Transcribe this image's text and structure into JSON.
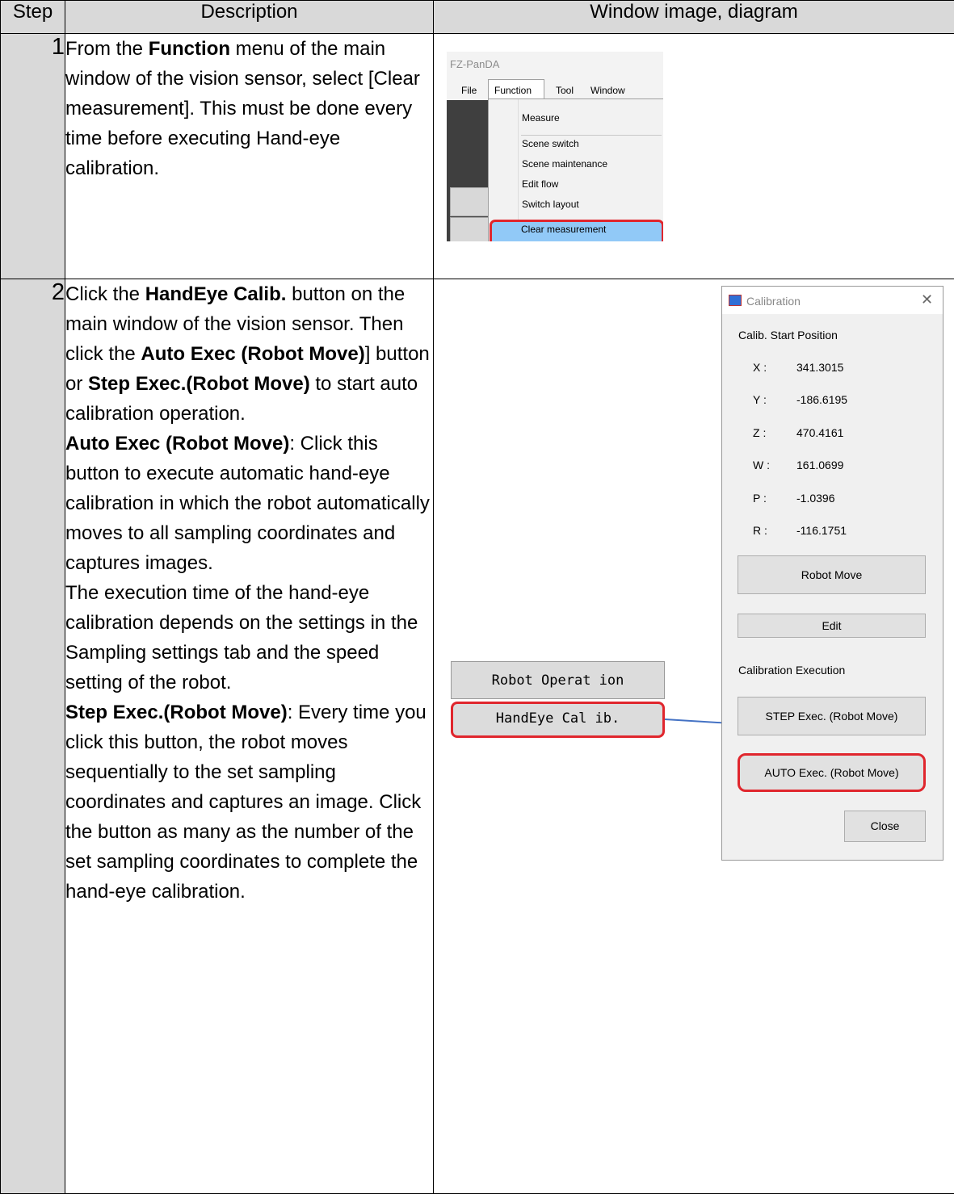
{
  "table": {
    "headers": [
      "Step",
      "Description",
      "Window image, diagram"
    ]
  },
  "step1": {
    "number": "1",
    "description_parts": [
      {
        "t": "From the ",
        "b": false
      },
      {
        "t": "Function",
        "b": true
      },
      {
        "t": " menu of the main window of the vision sensor, select [Clear measurement]. This must be done every time before executing Hand-eye calibration.",
        "b": false
      }
    ],
    "window": {
      "title": "FZ-PanDA",
      "menubar": [
        "File",
        "Function",
        "Tool",
        "Window"
      ],
      "menu_items": [
        "Measure",
        "Scene switch",
        "Scene maintenance",
        "Edit flow",
        "Switch layout",
        "Clear measurement"
      ],
      "highlighted_item": "Clear measurement"
    }
  },
  "step2": {
    "number": "2",
    "description_parts": [
      {
        "t": "Click the ",
        "b": false
      },
      {
        "t": "HandEye Calib.",
        "b": true
      },
      {
        "t": " button on the main window of the vision sensor. Then click the ",
        "b": false
      },
      {
        "t": "Auto Exec (Robot Move)",
        "b": true
      },
      {
        "t": "] button or ",
        "b": false
      },
      {
        "t": "Step Exec.(Robot Move)",
        "b": true
      },
      {
        "t": " to start auto calibration operation.",
        "b": false
      },
      {
        "br": true
      },
      {
        "t": "Auto Exec (Robot Move)",
        "b": true
      },
      {
        "t": ": Click this button to execute automatic hand-eye calibration in which the robot automatically moves to all sampling coordinates and captures images.",
        "b": false
      },
      {
        "br": true
      },
      {
        "t": "The execution time of the hand-eye calibration depends on the settings in the Sampling settings tab and the speed setting of the robot.",
        "b": false
      },
      {
        "br": true
      },
      {
        "t": "Step Exec.(Robot Move)",
        "b": true
      },
      {
        "t": ": Every time you click this button, the robot moves sequentially to the set sampling coordinates and captures an image. Click the button as many as the number of the set sampling coordinates to complete the hand-eye calibration.",
        "b": false
      }
    ],
    "main_buttons": {
      "robot_operation": "Robot Operat ion",
      "handeye_calib": "HandEye Cal ib."
    },
    "dialog": {
      "title": "Calibration",
      "close_glyph": "✕",
      "section_start": "Calib. Start Position",
      "coords": [
        {
          "axis": "X :",
          "value": "341.3015"
        },
        {
          "axis": "Y :",
          "value": "-186.6195"
        },
        {
          "axis": "Z :",
          "value": "470.4161"
        },
        {
          "axis": "W :",
          "value": "161.0699"
        },
        {
          "axis": "P :",
          "value": "-1.0396"
        },
        {
          "axis": "R :",
          "value": "-116.1751"
        }
      ],
      "robot_move_button": "Robot Move",
      "edit_button": "Edit",
      "section_exec": "Calibration Execution",
      "step_exec_button": "STEP Exec. (Robot Move)",
      "auto_exec_button": "AUTO Exec. (Robot Move)",
      "close_button": "Close"
    },
    "colors": {
      "highlight": "#e0262d",
      "arrow": "#4472c4",
      "selected_item": "#91c9f7"
    }
  }
}
